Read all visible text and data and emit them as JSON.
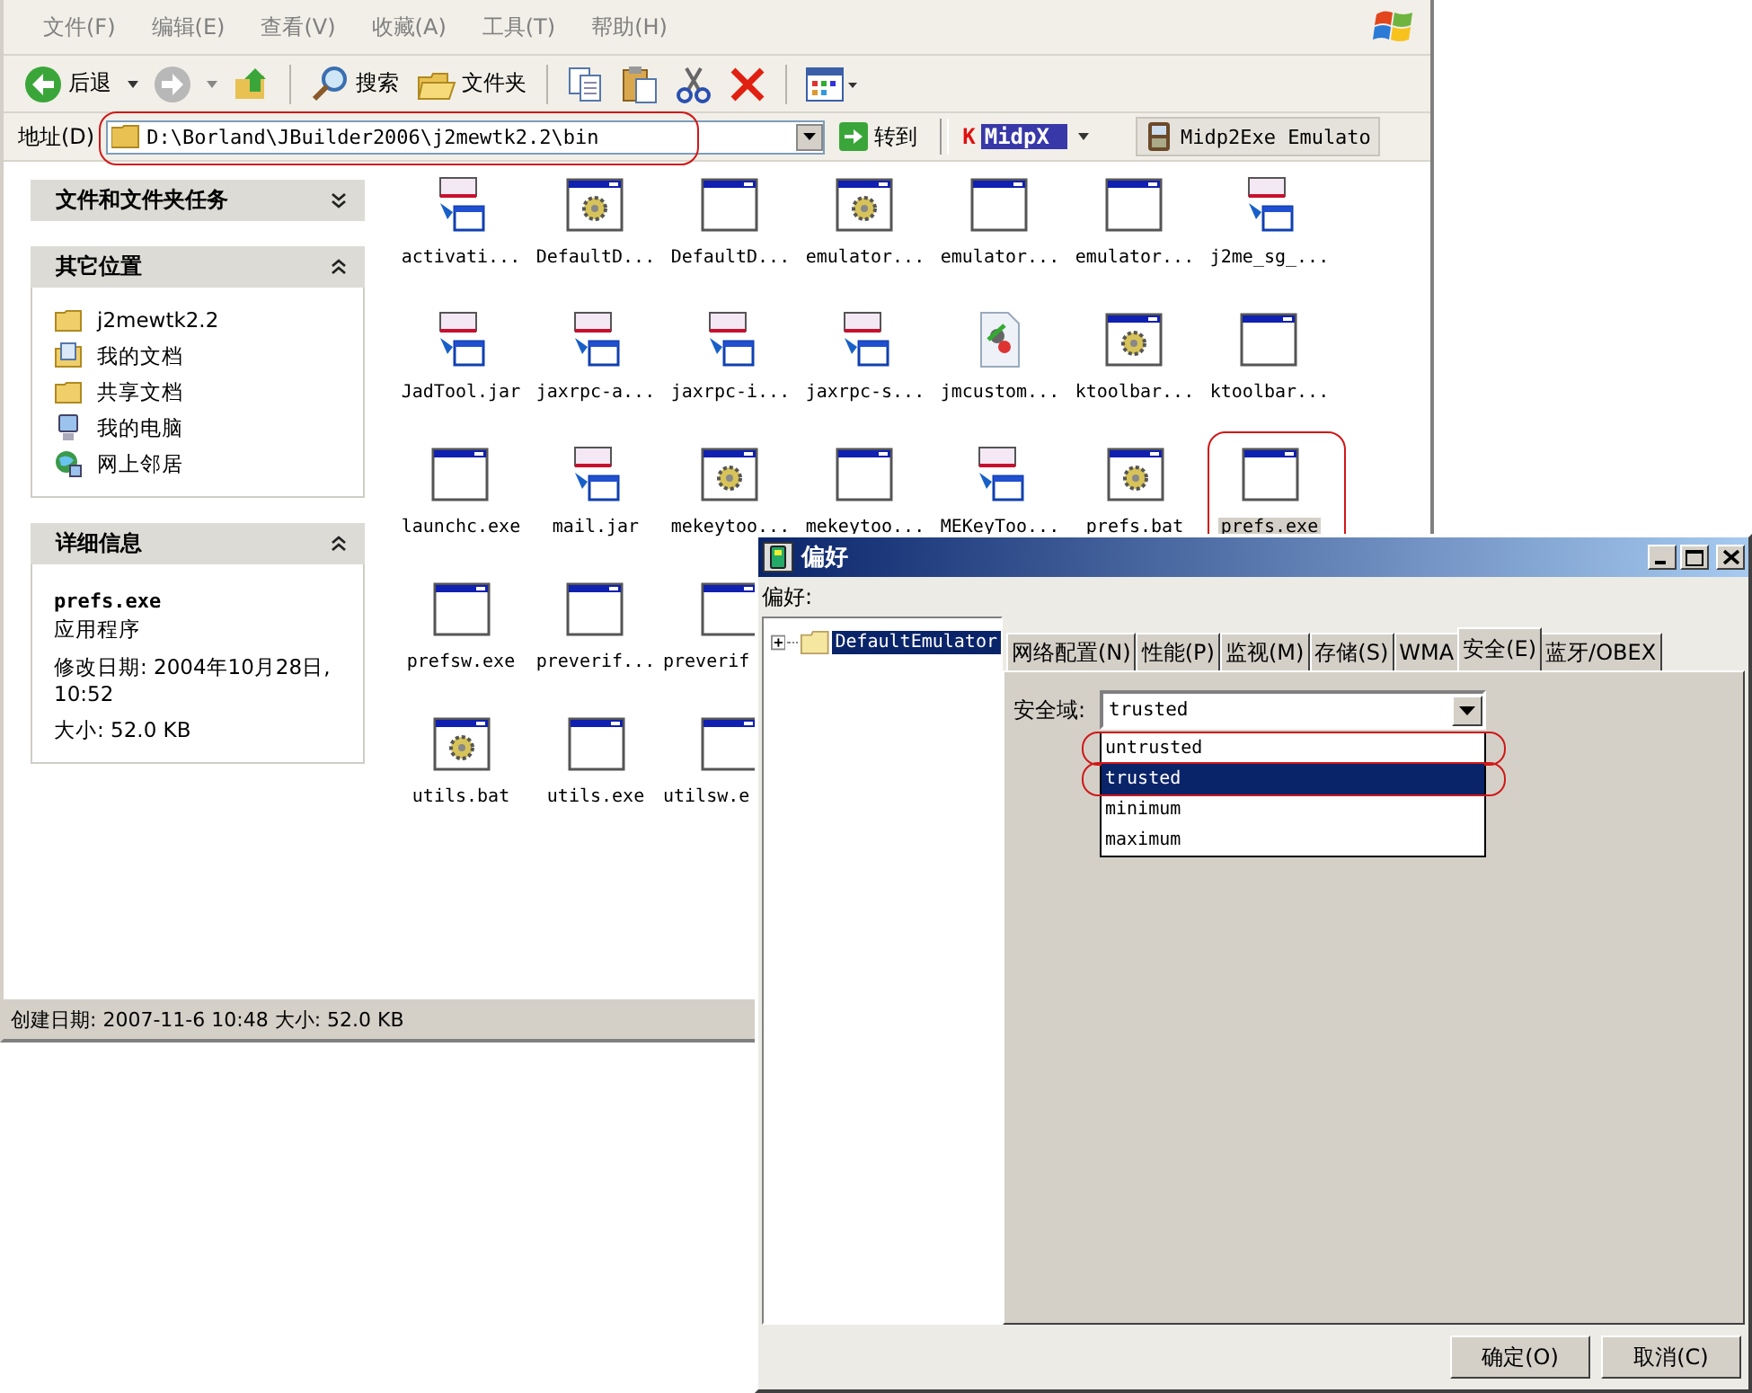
{
  "explorer": {
    "menu": [
      "文件(F)",
      "编辑(E)",
      "查看(V)",
      "收藏(A)",
      "工具(T)",
      "帮助(H)"
    ],
    "toolbar": {
      "back": "后退",
      "search": "搜索",
      "folders": "文件夹",
      "forward_disabled": true
    },
    "address": {
      "label": "地址(D)",
      "value": "D:\\Borland\\JBuilder2006\\j2mewtk2.2\\bin",
      "circled": true,
      "go": "转到"
    },
    "toolbar_extras": {
      "midpx_mark": "K",
      "midpx": "MidpX",
      "midp2exe": "Midp2Exe Emulato"
    },
    "task_panels": [
      {
        "title": "文件和文件夹任务",
        "expanded": false
      },
      {
        "title": "其它位置",
        "expanded": true,
        "links": [
          {
            "label": "j2mewtk2.2",
            "kind": "folder"
          },
          {
            "label": "我的文档",
            "kind": "documents"
          },
          {
            "label": "共享文档",
            "kind": "folder"
          },
          {
            "label": "我的电脑",
            "kind": "computer"
          },
          {
            "label": "网上邻居",
            "kind": "network"
          }
        ]
      },
      {
        "title": "详细信息",
        "expanded": true,
        "details": {
          "name": "prefs.exe",
          "type": "应用程序",
          "modified": "修改日期: 2004年10月28日, 10:52",
          "size": "大小: 52.0 KB"
        }
      }
    ],
    "file_rows": [
      [
        {
          "name": "activati...",
          "kind": "midp",
          "selected": false
        },
        {
          "name": "DefaultD...",
          "kind": "gear",
          "selected": false
        },
        {
          "name": "DefaultD...",
          "kind": "window",
          "selected": false
        },
        {
          "name": "emulator...",
          "kind": "gear",
          "selected": false
        },
        {
          "name": "emulator...",
          "kind": "window",
          "selected": false
        },
        {
          "name": "emulator...",
          "kind": "window",
          "selected": false
        },
        {
          "name": "j2me_sg_...",
          "kind": "midp",
          "selected": false
        }
      ],
      [
        {
          "name": "JadTool.jar",
          "kind": "midp",
          "selected": false
        },
        {
          "name": "jaxrpc-a...",
          "kind": "midp",
          "selected": false
        },
        {
          "name": "jaxrpc-i...",
          "kind": "midp",
          "selected": false
        },
        {
          "name": "jaxrpc-s...",
          "kind": "midp",
          "selected": false
        },
        {
          "name": "jmcustom...",
          "kind": "script",
          "selected": false
        },
        {
          "name": "ktoolbar...",
          "kind": "gear",
          "selected": false
        },
        {
          "name": "ktoolbar...",
          "kind": "window",
          "selected": false
        }
      ],
      [
        {
          "name": "launchc.exe",
          "kind": "window",
          "selected": false
        },
        {
          "name": "mail.jar",
          "kind": "midp",
          "selected": false
        },
        {
          "name": "mekeytoo...",
          "kind": "gear",
          "selected": false
        },
        {
          "name": "mekeytoo...",
          "kind": "window",
          "selected": false
        },
        {
          "name": "MEKeyToo...",
          "kind": "midp",
          "selected": false
        },
        {
          "name": "prefs.bat",
          "kind": "gear",
          "selected": false
        },
        {
          "name": "prefs.exe",
          "kind": "window",
          "selected": true,
          "circled": true
        }
      ],
      [
        {
          "name": "prefsw.exe",
          "kind": "window",
          "selected": false
        },
        {
          "name": "preverif...",
          "kind": "window",
          "selected": false
        },
        {
          "name": "preverif",
          "kind": "window",
          "selected": false,
          "clipped": true
        }
      ],
      [
        {
          "name": "utils.bat",
          "kind": "gear",
          "selected": false
        },
        {
          "name": "utils.exe",
          "kind": "window",
          "selected": false
        },
        {
          "name": "utilsw.e",
          "kind": "window",
          "selected": false,
          "clipped": true
        }
      ]
    ],
    "status_bar": "创建日期: 2007-11-6 10:48 大小: 52.0 KB"
  },
  "dialog": {
    "title": "偏好",
    "label": "偏好:",
    "tree": [
      {
        "label": "DefaultEmulator",
        "selected": true,
        "expanded": false
      }
    ],
    "tabs": [
      {
        "label": "网络配置(N)",
        "selected": false
      },
      {
        "label": "性能(P)",
        "selected": false
      },
      {
        "label": "监视(M)",
        "selected": false
      },
      {
        "label": "存储(S)",
        "selected": false
      },
      {
        "label": "WMA",
        "selected": false
      },
      {
        "label": "安全(E)",
        "selected": true
      },
      {
        "label": "蓝牙/OBEX",
        "selected": false
      }
    ],
    "field": {
      "label": "安全域:",
      "value": "trusted"
    },
    "options": [
      {
        "label": "untrusted",
        "selected": false,
        "circled": true
      },
      {
        "label": "trusted",
        "selected": true,
        "circled": true
      },
      {
        "label": "minimum",
        "selected": false,
        "circled": false
      },
      {
        "label": "maximum",
        "selected": false,
        "circled": false
      }
    ],
    "buttons": [
      "确定(O)",
      "取消(C)"
    ]
  }
}
